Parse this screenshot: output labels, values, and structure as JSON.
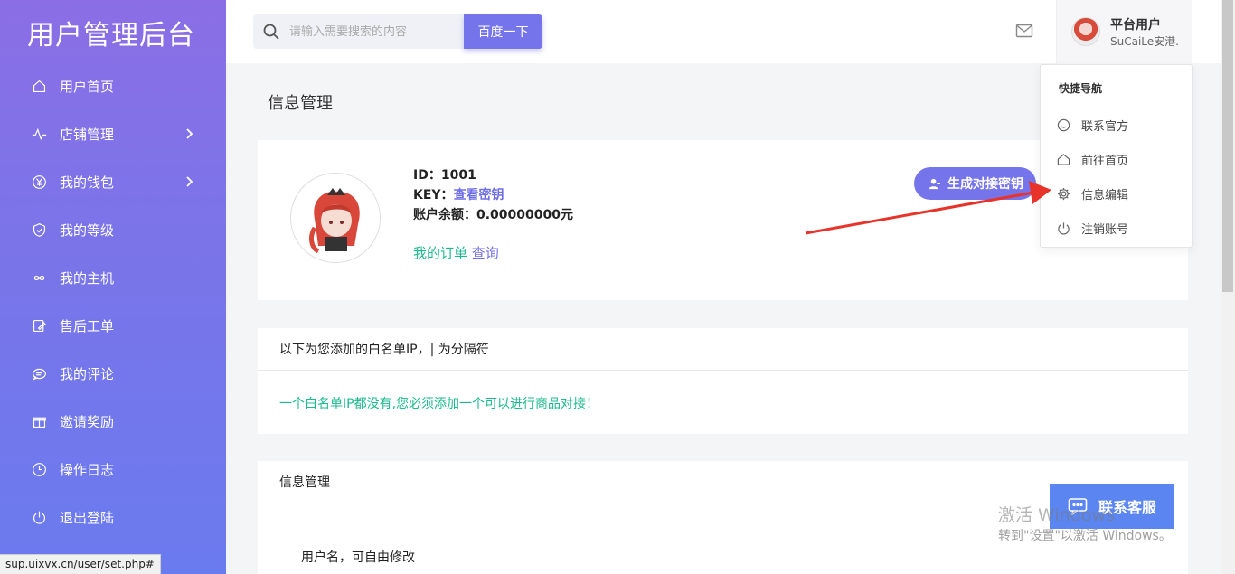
{
  "sidebar": {
    "brand": "用户管理后台",
    "items": [
      {
        "label": "用户首页",
        "icon": "home-icon",
        "has_arrow": false
      },
      {
        "label": "店铺管理",
        "icon": "activity-icon",
        "has_arrow": true
      },
      {
        "label": "我的钱包",
        "icon": "yen-icon",
        "has_arrow": true
      },
      {
        "label": "我的等级",
        "icon": "shield-icon",
        "has_arrow": false
      },
      {
        "label": "我的主机",
        "icon": "infinity-icon",
        "has_arrow": false
      },
      {
        "label": "售后工单",
        "icon": "edit-icon",
        "has_arrow": false
      },
      {
        "label": "我的评论",
        "icon": "comment-icon",
        "has_arrow": false
      },
      {
        "label": "邀请奖励",
        "icon": "gift-icon",
        "has_arrow": false
      },
      {
        "label": "操作日志",
        "icon": "clock-icon",
        "has_arrow": false
      },
      {
        "label": "退出登陆",
        "icon": "power-icon",
        "has_arrow": false
      }
    ]
  },
  "header": {
    "search_placeholder": "请输入需要搜索的内容",
    "search_button": "百度一下",
    "user_name": "平台用户",
    "user_sub": "SuCaiLe安港."
  },
  "dropdown": {
    "title": "快捷导航",
    "items": [
      {
        "label": "联系官方",
        "icon": "smile-icon"
      },
      {
        "label": "前往首页",
        "icon": "home-icon"
      },
      {
        "label": "信息编辑",
        "icon": "gear-icon"
      },
      {
        "label": "注销账号",
        "icon": "power-icon"
      }
    ]
  },
  "main": {
    "page_title": "信息管理",
    "profile": {
      "id_label": "ID：",
      "id_value": "1001",
      "key_label": "KEY：",
      "key_link": "查看密钥",
      "balance_label": "账户余额：",
      "balance_value": "0.00000000元",
      "orders_label": "我的订单",
      "orders_link": "查询",
      "generate_button": "生成对接密钥"
    },
    "whitelist": {
      "header": "以下为您添加的白名单IP，| 为分隔符",
      "message": "一个白名单IP都没有,您必须添加一个可以进行商品对接！"
    },
    "info_card": {
      "header": "信息管理",
      "username_row": "用户名，可自由修改"
    }
  },
  "contact_service": "联系客服",
  "watermark": {
    "line1": "激活 Windows",
    "line2": "转到\"设置\"以激活 Windows。"
  },
  "status_url": "sup.uixvx.cn/user/set.php#",
  "colors": {
    "accent": "#7674ea",
    "green": "#1cbb8c",
    "cs_blue": "#5b86f2",
    "arrow_red": "#e8332b"
  }
}
